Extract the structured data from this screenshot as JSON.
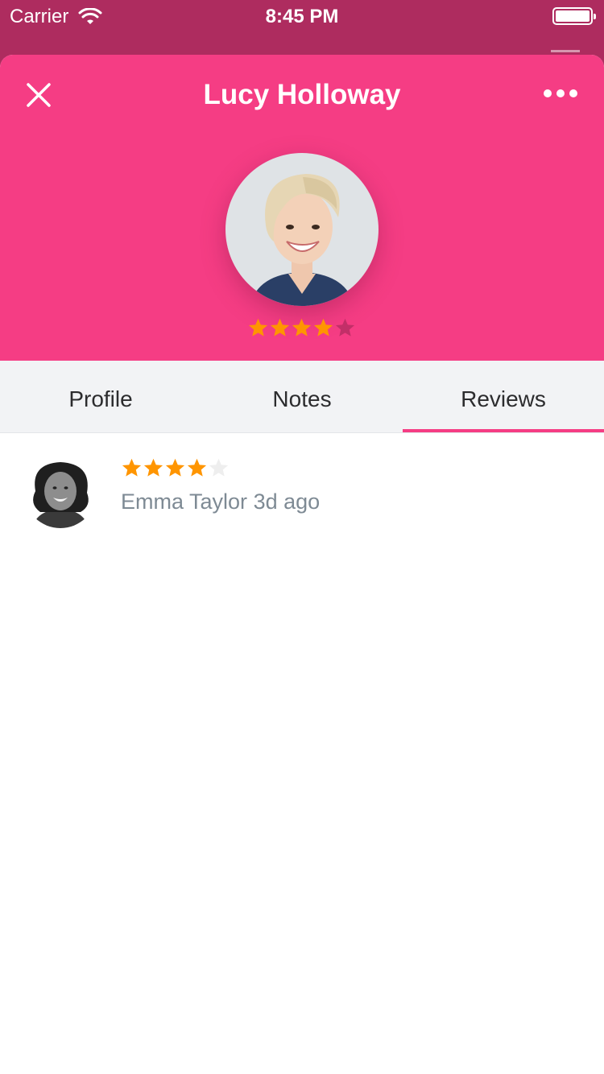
{
  "status_bar": {
    "carrier": "Carrier",
    "time": "8:45 PM"
  },
  "header": {
    "title": "Lucy Holloway",
    "close_icon": "close-icon",
    "more_icon": "more-horizontal-icon",
    "rating": 4,
    "rating_max": 5
  },
  "tabs": [
    {
      "label": "Profile",
      "active": false
    },
    {
      "label": "Notes",
      "active": false
    },
    {
      "label": "Reviews",
      "active": true
    }
  ],
  "reviews": [
    {
      "author": "Emma Taylor",
      "time_ago": "3d ago",
      "rating": 4,
      "rating_max": 5
    }
  ],
  "colors": {
    "accent": "#f53d84",
    "status_bar_bg": "#ae2c5f",
    "star_filled": "#ff9500",
    "star_empty_header": "#c22f68",
    "star_empty_review": "#eeeeee",
    "tab_bg": "#f2f3f5",
    "meta_text": "#7e8a94"
  }
}
